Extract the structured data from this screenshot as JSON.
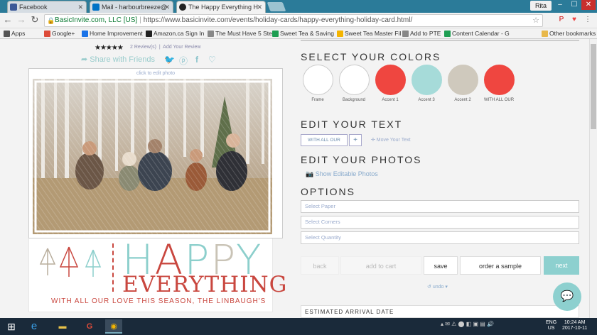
{
  "browser": {
    "tabs": [
      {
        "title": "Facebook",
        "favicon": "facebook-icon",
        "color": "#3b5998"
      },
      {
        "title": "Mail - harbourbreeze@",
        "favicon": "outlook-icon",
        "color": "#0072c6"
      },
      {
        "title": "The Happy Everything H",
        "favicon": "basicinvite-icon",
        "color": "#222"
      }
    ],
    "user": "Rita",
    "address": {
      "site": "BasicInvite.com, LLC [US]",
      "url": "https://www.basicinvite.com/events/holiday-cards/happy-everything-holiday-card.html/"
    },
    "bookmarks": [
      {
        "label": "Apps",
        "color": "#555"
      },
      {
        "label": "Google+",
        "color": "#dd4b39"
      },
      {
        "label": "Home Improvement",
        "color": "#1a73e8"
      },
      {
        "label": "Amazon.ca Sign In",
        "color": "#222"
      },
      {
        "label": "The Must Have 5 Ste",
        "color": "#888"
      },
      {
        "label": "Sweet Tea & Saving",
        "color": "#1e9e52"
      },
      {
        "label": "Sweet Tea Master Fil",
        "color": "#f4b400"
      },
      {
        "label": "Add to PTE",
        "color": "#888"
      },
      {
        "label": "Content Calendar - G",
        "color": "#1e9e52"
      },
      {
        "label": "Other bookmarks",
        "color": "#e8b84a"
      }
    ]
  },
  "card": {
    "stars": "★★★★★",
    "reviews": "2 Review(s)",
    "add_review": "Add Your Review",
    "share": "Share with Friends",
    "edit_photo": "click to edit photo",
    "happy": "HAPPY",
    "everything": "EVERYTHING",
    "tagline": "WITH ALL OUR LOVE THIS SEASON, THE LINBAUGH'S"
  },
  "colors": {
    "title": "SELECT YOUR COLORS",
    "swatches": [
      {
        "label": "Frame",
        "color": "#ffffff"
      },
      {
        "label": "Background",
        "color": "#ffffff"
      },
      {
        "label": "Accent 1",
        "color": "#ef4640"
      },
      {
        "label": "Accent 3",
        "color": "#a6dbd9"
      },
      {
        "label": "Accent 2",
        "color": "#cfc9bd"
      },
      {
        "label": "WITH ALL OUR",
        "color": "#ef4640"
      }
    ]
  },
  "edit_text": {
    "title": "EDIT YOUR TEXT",
    "line": "WITH ALL OUR",
    "plus": "+",
    "move": "✛ Move Your Text"
  },
  "edit_photos": {
    "title": "EDIT YOUR PHOTOS",
    "show": "Show Editable Photos"
  },
  "options": {
    "title": "OPTIONS",
    "paper": "Select Paper",
    "corners": "Select Corners",
    "quantity": "Select Quantity"
  },
  "actions": {
    "back": "back",
    "add_to_cart": "add to cart",
    "save": "save",
    "order_sample": "order a sample",
    "next": "next",
    "undo": "undo"
  },
  "arrival": "ESTIMATED ARRIVAL DATE",
  "taskbar": {
    "lang": "ENG",
    "region": "US",
    "time": "10:24 AM",
    "date": "2017-10-11"
  }
}
